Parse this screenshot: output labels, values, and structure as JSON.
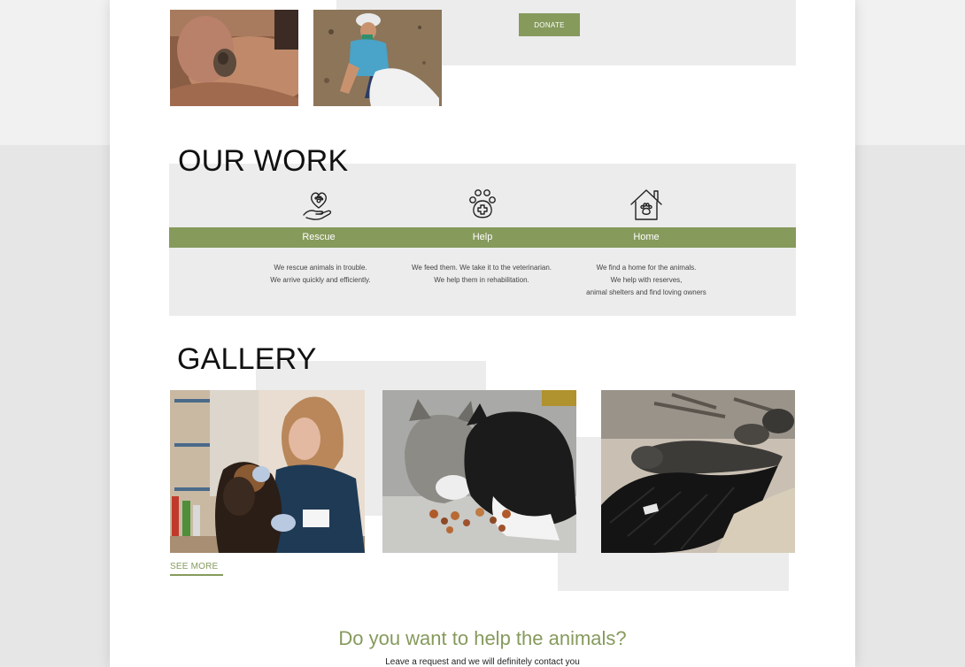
{
  "donate": {
    "label": "DONATE"
  },
  "work": {
    "title": "OUR WORK",
    "items": [
      {
        "icon": "hand-heart-paw-icon",
        "label": "Rescue",
        "lines": [
          "We rescue animals in trouble.",
          "We arrive quickly and efficiently."
        ]
      },
      {
        "icon": "paw-medical-cross-icon",
        "label": "Help",
        "lines": [
          "We feed them. We take it to the veterinarian.",
          "We help them in rehabilitation."
        ]
      },
      {
        "icon": "house-paw-icon",
        "label": "Home",
        "lines": [
          "We find a home for the animals.",
          "We help with reserves,",
          "animal shelters and find loving owners"
        ]
      }
    ]
  },
  "gallery": {
    "title": "GALLERY",
    "see_more": "SEE MORE"
  },
  "cta": {
    "title": "Do you want to help the animals?",
    "subtitle": "Leave a request and we will definitely contact you"
  },
  "colors": {
    "accent": "#869a5c",
    "panel": "#ececec",
    "backdrop": "#e6e6e6"
  }
}
